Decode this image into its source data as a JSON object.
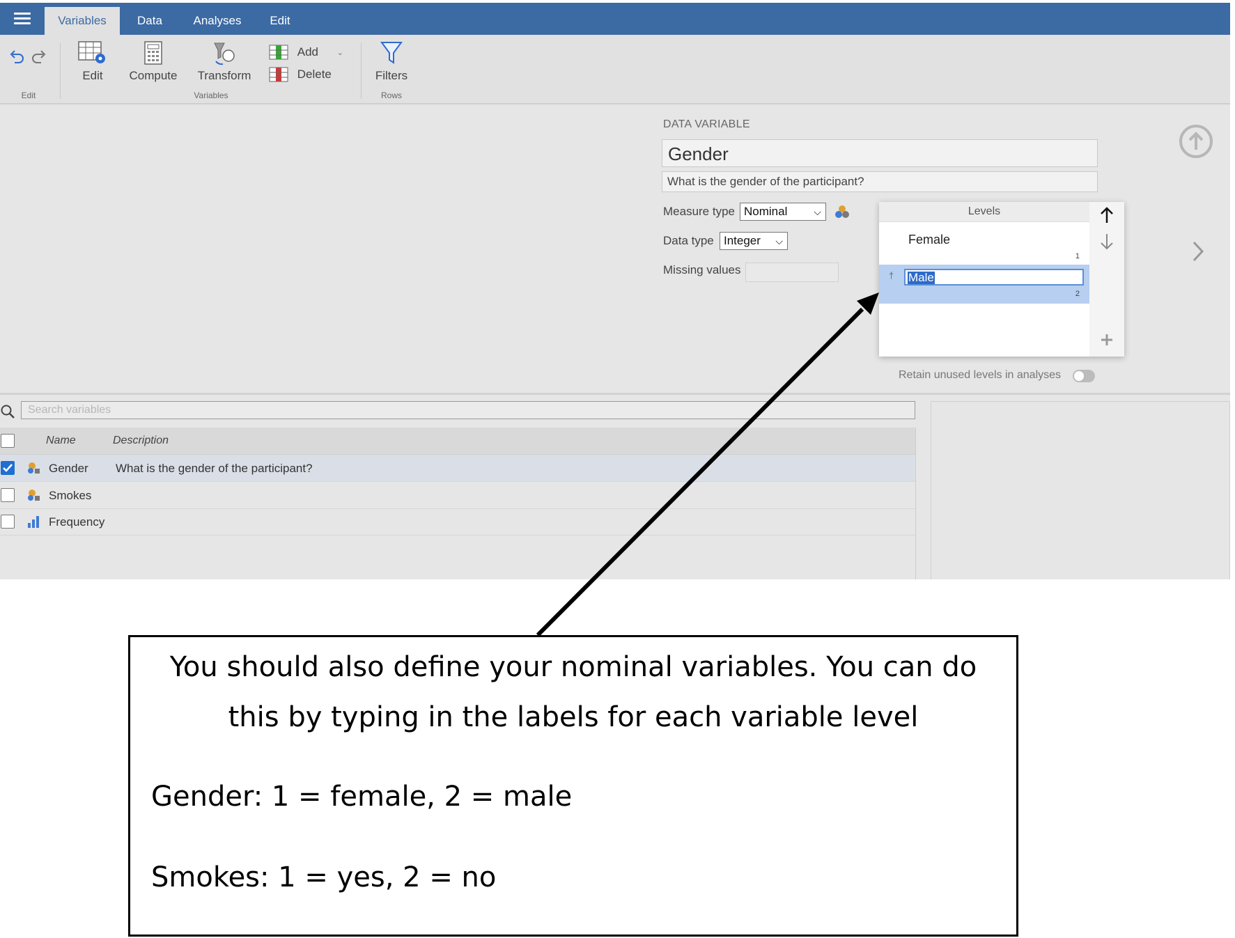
{
  "tabs": [
    "Variables",
    "Data",
    "Analyses",
    "Edit"
  ],
  "active_tab": "Variables",
  "ribbon": {
    "edit_group": "Edit",
    "edit_btn": "Edit",
    "compute_btn": "Compute",
    "transform_btn": "Transform",
    "variables_group": "Variables",
    "add_btn": "Add",
    "delete_btn": "Delete",
    "filters_btn": "Filters",
    "rows_group": "Rows"
  },
  "editor": {
    "section_label": "DATA VARIABLE",
    "name": "Gender",
    "description": "What is the gender of the participant?",
    "measure_type_label": "Measure type",
    "measure_type": "Nominal",
    "data_type_label": "Data type",
    "data_type": "Integer",
    "missing_label": "Missing values",
    "levels_header": "Levels",
    "levels": [
      {
        "label": "Female",
        "value": "1"
      },
      {
        "label": "Male",
        "value": "2"
      }
    ],
    "retain_label": "Retain unused levels in analyses"
  },
  "search": {
    "placeholder": "Search variables"
  },
  "table": {
    "headers": [
      "Name",
      "Description"
    ],
    "rows": [
      {
        "name": "Gender",
        "description": "What is the gender of the participant?",
        "type": "nominal",
        "checked": true
      },
      {
        "name": "Smokes",
        "description": "",
        "type": "nominal",
        "checked": false
      },
      {
        "name": "Frequency",
        "description": "",
        "type": "continuous",
        "checked": false
      }
    ]
  },
  "annotation": {
    "line1": "You should also define your nominal variables. You can do",
    "line2": "this by typing in the labels for each variable level",
    "line3": "Gender: 1 = female, 2 = male",
    "line4": "Smokes: 1 = yes, 2 = no"
  },
  "colors": {
    "tabbar": "#3c6aa3",
    "selection": "#2d6ac9",
    "selected_row": "#dadfe7",
    "checkbox_on": "#1f6fd1",
    "nominal_icon": "#e0a030",
    "continuous_icon": "#3f7bd4"
  }
}
